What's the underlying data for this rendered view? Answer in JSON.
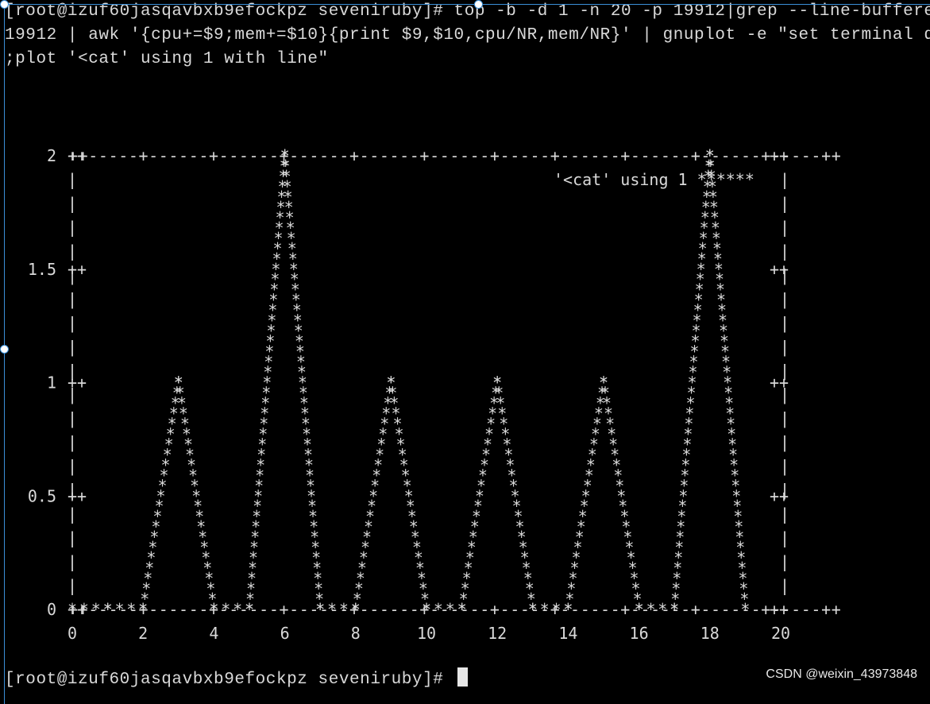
{
  "terminal": {
    "command_lines": [
      "[root@izuf60jasqavbxb9efockpz seveniruby]# top -b -d 1 -n 20 -p 19912|grep --line-buffered",
      "19912 | awk '{cpu+=$9;mem+=$10}{print $9,$10,cpu/NR,mem/NR}' | gnuplot -e \"set terminal du",
      ";plot '<cat' using 1 with line\""
    ],
    "prompt": "[root@izuf60jasqavbxb9efockpz seveniruby]# "
  },
  "colors": {
    "background": "#000000",
    "foreground": "#d9d9d9",
    "selection_border": "#3a8fd8"
  },
  "chart_data": {
    "type": "line",
    "legend": "'<cat' using 1 ******",
    "legend_position": "top-right",
    "marker": "*",
    "xlim": [
      0,
      20
    ],
    "ylim": [
      0,
      2
    ],
    "x_ticks": [
      "0",
      "2",
      "4",
      "6",
      "8",
      "10",
      "12",
      "14",
      "16",
      "18",
      "20"
    ],
    "y_ticks": [
      "0",
      "0.5",
      "1",
      "1.5",
      "2"
    ],
    "series": [
      {
        "x": [
          0,
          1,
          2,
          3,
          4,
          5,
          6,
          7,
          8,
          9,
          10,
          11,
          12,
          13,
          14,
          15,
          16,
          17,
          18,
          19
        ],
        "values": [
          0,
          0,
          0,
          1,
          0,
          0,
          2,
          0,
          0,
          1,
          0,
          0,
          1,
          0,
          0,
          1,
          0,
          0,
          2,
          0
        ]
      }
    ]
  },
  "watermark": "CSDN @weixin_43973848"
}
